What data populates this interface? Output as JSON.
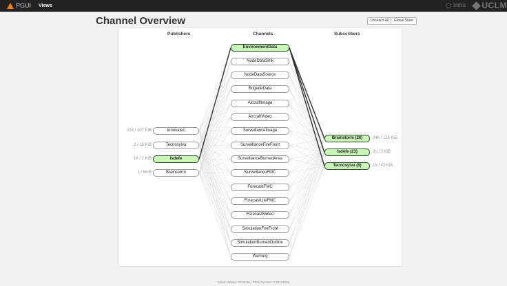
{
  "app": {
    "name": "PGUI",
    "nav_views": "Views"
  },
  "logos": {
    "indra": "indra",
    "uclm": "UCLM"
  },
  "page_title": "Channel Overview",
  "buttons": {
    "unselect_all": "Unselect All",
    "global_state": "Global State"
  },
  "headers": {
    "publishers": "Publishers",
    "channels": "Channels",
    "subscribers": "Subscribers"
  },
  "publishers": [
    {
      "name": "Innovatec",
      "size": "214 / 107 KiB",
      "selected": false
    },
    {
      "name": "Tecnosylva",
      "size": "2 / 25 KiB",
      "selected": false
    },
    {
      "name": "Isdefe",
      "size": "16 / 2 KiB",
      "selected": true
    },
    {
      "name": "Brainstorm",
      "size": "1 / 68 B",
      "selected": false
    }
  ],
  "channels": [
    {
      "name": "EnvironmentData",
      "selected": true
    },
    {
      "name": "NodeDataSink",
      "selected": false
    },
    {
      "name": "NodeDataSource",
      "selected": false
    },
    {
      "name": "BrigadeData",
      "selected": false
    },
    {
      "name": "AircraftImage",
      "selected": false
    },
    {
      "name": "AircraftVideo",
      "selected": false
    },
    {
      "name": "SurveillanceImage",
      "selected": false
    },
    {
      "name": "SurveillanceFireFront",
      "selected": false
    },
    {
      "name": "SurveillanceBurnedArea",
      "selected": false
    },
    {
      "name": "SurveillanceFMC",
      "selected": false
    },
    {
      "name": "ForecastFMC",
      "selected": false
    },
    {
      "name": "ForecastLiteFMC",
      "selected": false
    },
    {
      "name": "ForecastMeteo",
      "selected": false
    },
    {
      "name": "SimulationFireFront",
      "selected": false
    },
    {
      "name": "SimulationBurnedOutline",
      "selected": false
    },
    {
      "name": "Warning",
      "selected": false
    }
  ],
  "subscribers": [
    {
      "name": "Brainstorm (26)",
      "size": "246 / 135 KiB",
      "selected": true
    },
    {
      "name": "Isdefe (23)",
      "size": "30 / 3 KiB",
      "selected": true
    },
    {
      "name": "Tecnosylva (8)",
      "size": "19 / 43 KiB",
      "selected": true
    }
  ],
  "footer": "Client Uptime: 00:26:59 / PGUI Version: 0.20131025",
  "colors": {
    "selected_fill": "#c9f5b9",
    "selected_border": "#2e4d2a",
    "topbar": "#222222",
    "brand_accent": "#f07c20"
  }
}
